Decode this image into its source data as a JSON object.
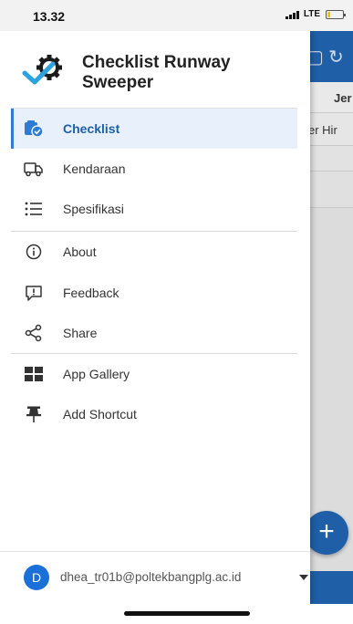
{
  "status_bar": {
    "time": "13.32",
    "network": "LTE"
  },
  "background_app": {
    "tab_partial": "Jer",
    "columns_partial": "er  Hir"
  },
  "drawer": {
    "app_title": "Checklist Runway Sweeper",
    "menu": [
      {
        "label": "Checklist",
        "icon": "clipboard-check-icon",
        "active": true
      },
      {
        "label": "Kendaraan",
        "icon": "truck-icon"
      },
      {
        "label": "Spesifikasi",
        "icon": "list-icon"
      },
      {
        "label": "About",
        "icon": "info-icon"
      },
      {
        "label": "Feedback",
        "icon": "feedback-icon"
      },
      {
        "label": "Share",
        "icon": "share-icon"
      },
      {
        "label": "App Gallery",
        "icon": "grid-icon"
      },
      {
        "label": "Add Shortcut",
        "icon": "pin-icon"
      }
    ],
    "account": {
      "avatar_letter": "D",
      "email": "dhea_tr01b@poltekbangplg.ac.id"
    }
  },
  "colors": {
    "primary": "#1f5fa8",
    "active_bg": "#e8f0fb",
    "accent": "#2e7bd6",
    "logo_check": "#2aa3e0"
  }
}
